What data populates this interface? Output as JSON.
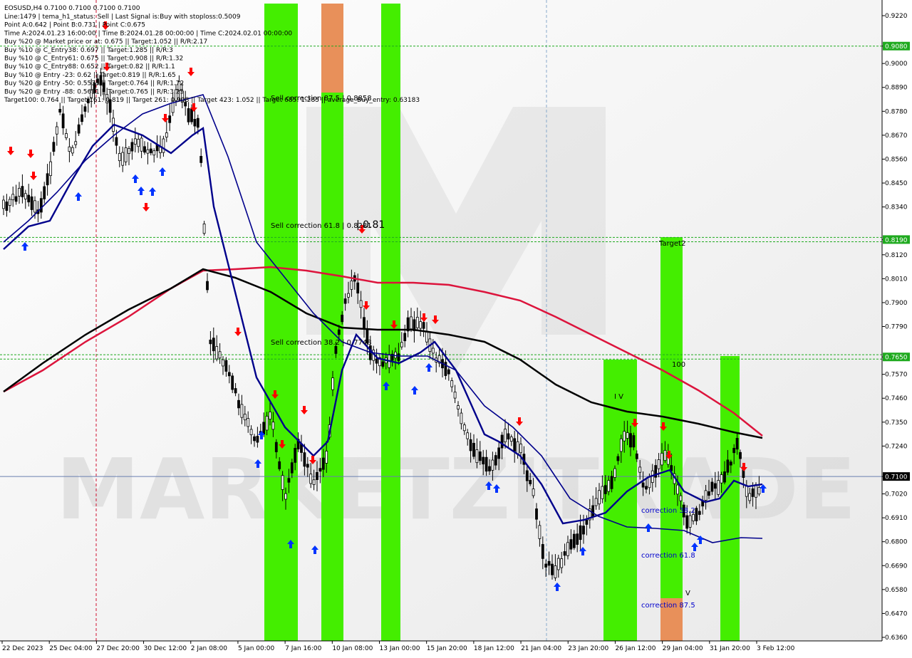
{
  "chart_data": {
    "type": "candlestick",
    "title": "EOSUSD,H4  0.7100 0.7100 0.7100 0.7100",
    "info_lines": [
      "Line:1479 | tema_h1_status: Sell | Last Signal is:Buy with stoploss:0.5009",
      "Point A:0.642 | Point B:0.731 | Point C:0.675",
      "Time A:2024.01.23 16:00:00 | Time B:2024.01.28 00:00:00 | Time C:2024.02.01 00:00:00",
      "Buy %20 @ Market price or at: 0.675 || Target:1.052 || R/R:2.17",
      "Buy %10 @ C_Entry38: 0.697 || Target:1.285 || R/R:3",
      "Buy %10 @ C_Entry61: 0.675 || Target:0.908 || R/R:1.32",
      "Buy %10 @ C_Entry88: 0.652 || Target:0.82 || R/R:1.1",
      "Buy %10 @ Entry -23: 0.62 || Target:0.819 || R/R:1.65",
      "Buy %20 @ Entry -50: 0.5535 || Target:0.764 || R/R:1.72",
      "Buy %20 @ Entry -88: 0.5631 || Target:0.765 || R/R:3.25",
      "Target100: 0.764 || Target 161: 0.819 || Target 261: 0.908 || Target 423: 1.052 || Target 685: 1.285 || average_Buy_entry: 0.63183"
    ],
    "watermark": "MARKETZITRADE",
    "y_ticks": [
      "0.9220",
      "0.9080",
      "0.9000",
      "0.8890",
      "0.8780",
      "0.8670",
      "0.8560",
      "0.8450",
      "0.8340",
      "0.8190",
      "0.8120",
      "0.8010",
      "0.7900",
      "0.7790",
      "0.7650",
      "0.7570",
      "0.7460",
      "0.7350",
      "0.7240",
      "0.7100",
      "0.7020",
      "0.6910",
      "0.6800",
      "0.6690",
      "0.6580",
      "0.6470",
      "0.6360"
    ],
    "ylim": [
      0.636,
      0.922
    ],
    "x_ticks": [
      "22 Dec 2023",
      "25 Dec 04:00",
      "27 Dec 20:00",
      "30 Dec 12:00",
      "2 Jan 08:00",
      "5 Jan 00:00",
      "7 Jan 16:00",
      "10 Jan 08:00",
      "13 Jan 00:00",
      "15 Jan 20:00",
      "18 Jan 12:00",
      "21 Jan 04:00",
      "23 Jan 20:00",
      "26 Jan 12:00",
      "29 Jan 04:00",
      "31 Jan 20:00",
      "3 Feb 12:00"
    ],
    "price_badges": [
      {
        "label": "0.9080",
        "value": 0.908,
        "color": "#1faa1f"
      },
      {
        "label": "0.8190",
        "value": 0.819,
        "color": "#1faa1f"
      },
      {
        "label": "0.7650",
        "value": 0.765,
        "color": "#1faa1f"
      },
      {
        "label": "0.7100",
        "value": 0.71,
        "color": "#000000"
      }
    ],
    "horizontal_levels": [
      0.908,
      0.82,
      0.818,
      0.766,
      0.764
    ],
    "current_price": 0.71,
    "annotations": [
      {
        "text": "Sell correction 87.5 | 0.8858",
        "color": "#000000"
      },
      {
        "text": "Sell correction 61.8 | 0.8281",
        "color": "#000000"
      },
      {
        "text": "| 0.81",
        "color": "#000000"
      },
      {
        "text": "Sell correction 38.2 | 0.7748",
        "color": "#000000"
      },
      {
        "text": "Target2",
        "color": "#000000"
      },
      {
        "text": "100",
        "color": "#000000"
      },
      {
        "text": "correction 38.2",
        "color": "#0000cc"
      },
      {
        "text": "correction 61.8",
        "color": "#0000cc"
      },
      {
        "text": "correction 87.5",
        "color": "#0000cc"
      },
      {
        "text": "I V",
        "color": "#000000"
      },
      {
        "text": "V",
        "color": "#000000"
      }
    ],
    "colors": {
      "up_candle": "#ffffff",
      "down_candle": "#000000",
      "wick": "#000000",
      "ma_fast": "#00008b",
      "ma_slow": "#00008b",
      "ma_black": "#000000",
      "ma_red": "#dc143c",
      "zone_green": "#44ee00",
      "zone_orange": "#e8905a",
      "level_green": "#1faa1f",
      "buy_arrow": "#0033ff",
      "sell_arrow": "#ff0000",
      "bg": "#ffffff",
      "watermark": "#d8d8d8"
    }
  }
}
